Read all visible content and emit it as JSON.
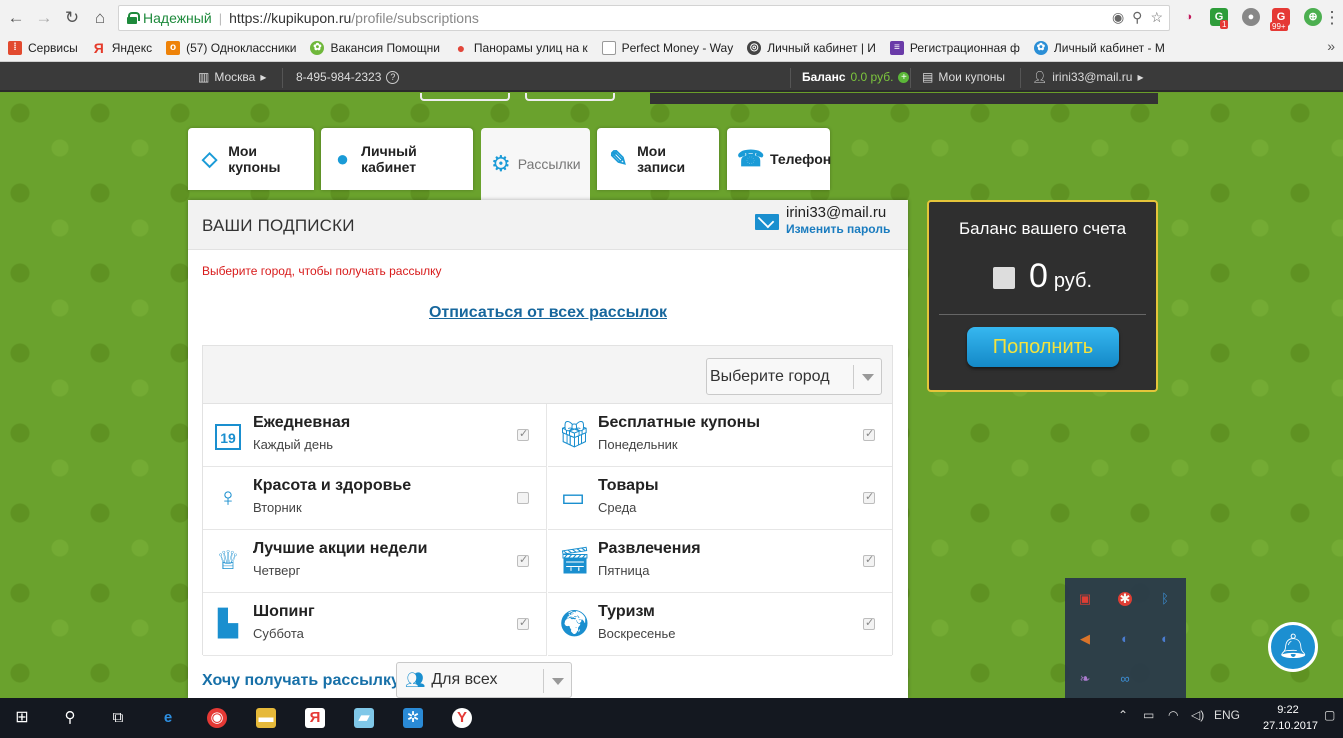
{
  "browser": {
    "secure_label": "Надежный",
    "url_host": "https://kupikupon.ru",
    "url_path": "/profile/subscriptions",
    "extension_badges": [
      "1",
      "99+"
    ],
    "bookmarks": [
      {
        "label": "Сервисы",
        "icon": "apps-grid-icon",
        "color": "#e24a2f"
      },
      {
        "label": "Яндекс",
        "icon": "yandex-icon",
        "color": "#e53a2a"
      },
      {
        "label": "(57) Одноклассники",
        "icon": "odnoklassniki-icon",
        "color": "#ee8208"
      },
      {
        "label": "Вакансия Помощни",
        "icon": "clover-icon",
        "color": "#6fb73b"
      },
      {
        "label": "Панорамы улиц на к",
        "icon": "map-pin-icon",
        "color": "#e2463a"
      },
      {
        "label": "Perfect Money - Way",
        "icon": "page-icon",
        "color": "#999999"
      },
      {
        "label": "Личный кабинет | И",
        "icon": "globe-icon",
        "color": "#444444"
      },
      {
        "label": "Регистрационная ф",
        "icon": "form-icon",
        "color": "#6a3ba8"
      },
      {
        "label": "Личный кабинет - М",
        "icon": "clover-icon",
        "color": "#2b8fd6"
      }
    ]
  },
  "topbar": {
    "city": "Москва",
    "phone": "8-495-984-2323",
    "balance_label": "Баланс",
    "balance_value": "0.0 руб.",
    "my_coupons": "Мои купоны",
    "user": "irini33@mail.ru"
  },
  "tabs": [
    {
      "label": "Мои купоны",
      "icon": "tag-icon",
      "active": false
    },
    {
      "label": "Личный кабинет",
      "icon": "user-icon",
      "active": false
    },
    {
      "label": "Рассылки",
      "icon": "gear-icon",
      "active": true
    },
    {
      "label": "Мои записи",
      "icon": "edit-icon",
      "active": false
    },
    {
      "label": "Телефон",
      "icon": "phone-icon",
      "active": false
    }
  ],
  "panel": {
    "title": "ВАШИ ПОДПИСКИ",
    "email": "irini33@mail.ru",
    "change_password": "Изменить пароль",
    "warning": "Выберите город, чтобы получать рассылку",
    "unsubscribe_all": "Отписаться от всех рассылок",
    "city_select": "Выберите город",
    "want_label": "Хочу получать рассылку:",
    "audience_select": "Для всех"
  },
  "subscriptions": [
    {
      "name": "Ежедневная",
      "day": "Каждый день",
      "icon": "calendar-icon",
      "checked": true
    },
    {
      "name": "Бесплатные купоны",
      "day": "Понедельник",
      "icon": "gift-icon",
      "checked": true
    },
    {
      "name": "Красота и здоровье",
      "day": "Вторник",
      "icon": "woman-icon",
      "checked": false
    },
    {
      "name": "Товары",
      "day": "Среда",
      "icon": "laptop-icon",
      "checked": true
    },
    {
      "name": "Лучшие акции недели",
      "day": "Четверг",
      "icon": "trophy-icon",
      "checked": true
    },
    {
      "name": "Развлечения",
      "day": "Пятница",
      "icon": "clapperboard-icon",
      "checked": true
    },
    {
      "name": "Шопинг",
      "day": "Суббота",
      "icon": "boot-icon",
      "checked": true
    },
    {
      "name": "Туризм",
      "day": "Воскресенье",
      "icon": "globe-icon",
      "checked": true
    }
  ],
  "balance": {
    "title": "Баланс вашего счета",
    "amount": "0",
    "currency": "руб.",
    "topup_button": "Пополнить"
  },
  "taskbar": {
    "language": "ENG",
    "time": "9:22",
    "date": "27.10.2017"
  },
  "colors": {
    "accent": "#1a8fcf",
    "page_green": "#6aa22d",
    "warning": "#d81b1b",
    "topup_text": "#f3e23e",
    "balance_border": "#e5c53a"
  }
}
